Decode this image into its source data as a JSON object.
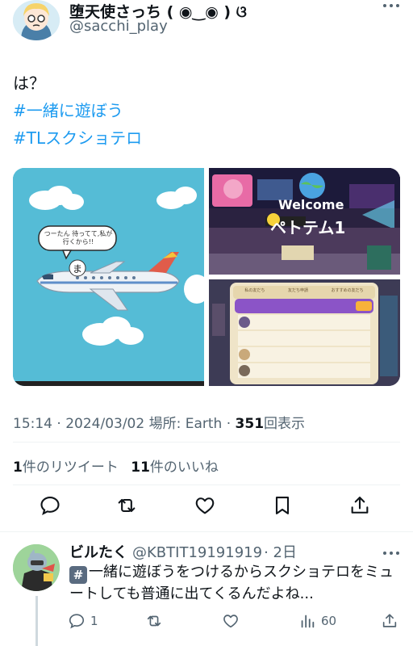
{
  "tweet": {
    "display_name": "堕天使さっち ( ◉‿◉ ) ଓ",
    "handle": "@sacchi_play",
    "text_line1": "は？",
    "hashtag1": "#一緒に遊ぼう",
    "hashtag2": "#TLスクショテロ",
    "time": "15:14 · 2024/03/02 ",
    "location_label": "場所: Earth · ",
    "views_count": "351",
    "views_label": "回表示",
    "retweets_count": "1",
    "retweets_label": "件のリツイート",
    "likes_count": "11",
    "likes_label": "件のいいね"
  },
  "media": {
    "image1": {
      "bubble_text_line1": "つーたん 待ってて,私が",
      "bubble_text_line2": "行くから!!"
    },
    "image2": {
      "welcome_text": "Welcome",
      "title_text": "ペトテム1"
    },
    "image3": {
      "tab_labels": [
        "私の友だち",
        "友だち申請",
        "おすすめの友だち"
      ]
    }
  },
  "reply": {
    "display_name": "ビルたく",
    "handle": "@KBTIT19191919",
    "time": "· 2日",
    "keycap": "#",
    "text": "一緒に遊ぼうをつけるからスクショテロをミュートしても普通に出てくるんだよね...",
    "reply_count": "1",
    "views_count": "60"
  },
  "icons": {
    "reply": "reply-icon",
    "retweet": "retweet-icon",
    "like": "heart-icon",
    "bookmark": "bookmark-icon",
    "share": "share-icon",
    "views": "views-icon",
    "more": "more-icon"
  },
  "colors": {
    "accent": "#1d9bf0",
    "secondary_text": "#536471",
    "primary_text": "#0f1419"
  }
}
